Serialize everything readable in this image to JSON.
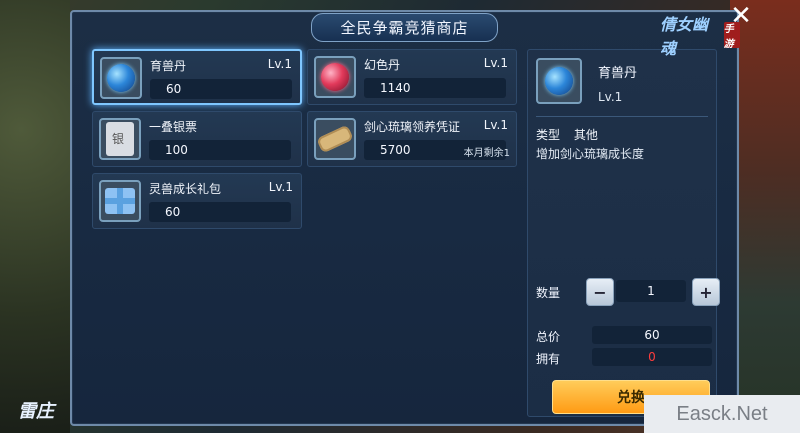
{
  "window": {
    "title": "全民争霸竞猜商店",
    "logo_text": "倩女幽魂",
    "logo_seal": "手游",
    "close_icon": "close-icon",
    "corner_logo_text": "雷庄"
  },
  "items": [
    {
      "name": "育兽丹",
      "level": "Lv.1",
      "price": "60",
      "icon": "blue-orb-icon",
      "selected": true
    },
    {
      "name": "幻色丹",
      "level": "Lv.1",
      "price": "1140",
      "icon": "red-orb-icon",
      "selected": false
    },
    {
      "name": "一叠银票",
      "level": "",
      "price": "100",
      "icon": "silver-note-icon",
      "selected": false
    },
    {
      "name": "剑心琉璃领养凭证",
      "level": "Lv.1",
      "price": "5700",
      "note": "本月剩余1",
      "icon": "scroll-icon",
      "selected": false
    },
    {
      "name": "灵兽成长礼包",
      "level": "Lv.1",
      "price": "60",
      "icon": "gift-box-icon",
      "selected": false
    }
  ],
  "detail": {
    "name": "育兽丹",
    "level": "Lv.1",
    "type_label": "类型",
    "type_value": "其他",
    "description": "增加剑心琉璃成长度",
    "quantity_label": "数量",
    "quantity": "1",
    "total_label": "总价",
    "total_value": "60",
    "owned_label": "拥有",
    "owned_value": "0",
    "exchange_button": "兑换"
  },
  "watermark": "Easck.Net",
  "colors": {
    "panel_bg": "#182a42",
    "accent_border": "#6e8aa9",
    "selected_glow": "#5fb3ff",
    "exchange_btn": "#ff9b14",
    "owned_red": "#ff3c3c"
  }
}
